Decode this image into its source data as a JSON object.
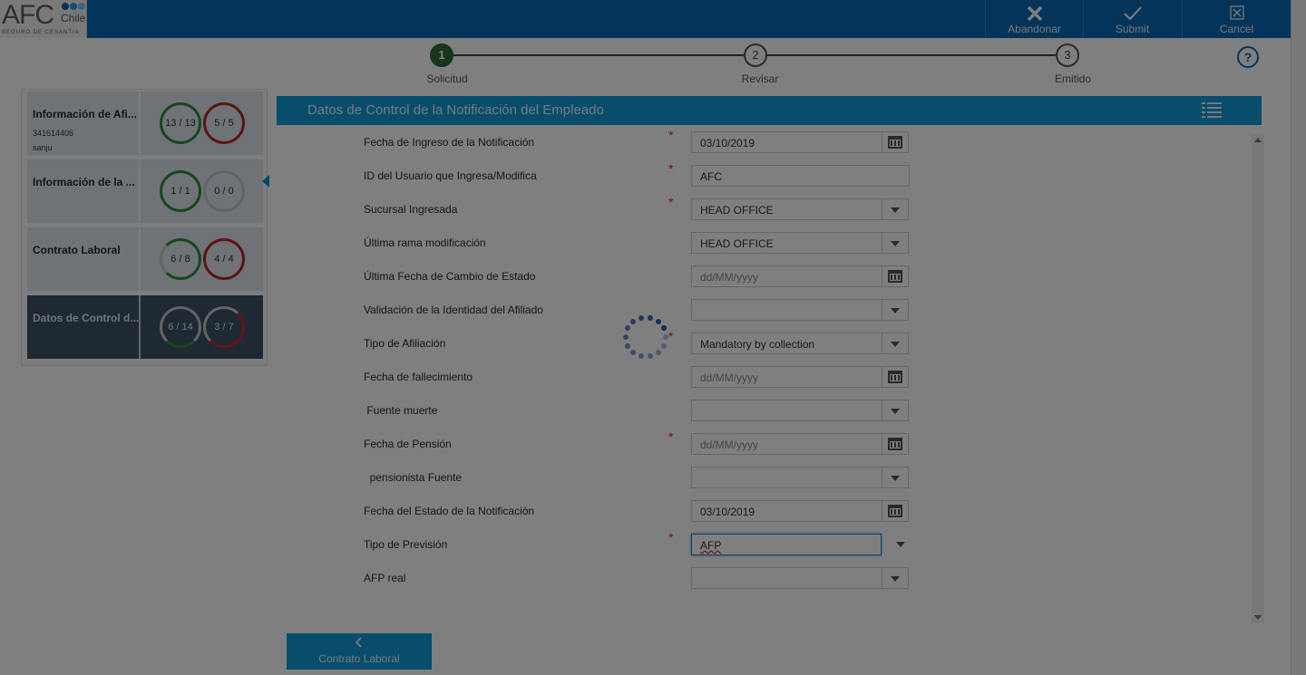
{
  "header": {
    "logo": {
      "brand": "AFC",
      "country": "Chile",
      "tagline": "SEGURO DE CESANTIA",
      "dot_colors": [
        "#1c5aa8",
        "#2f9be0",
        "#7ec7f0"
      ]
    },
    "actions": [
      {
        "label": "Abandonar",
        "icon": "close-x-icon"
      },
      {
        "label": "Submit",
        "icon": "checkmark-icon"
      },
      {
        "label": "Cancel",
        "icon": "cancel-box-icon"
      }
    ]
  },
  "stepper": {
    "steps": [
      {
        "number": "1",
        "label": "Solicitud",
        "active": true
      },
      {
        "number": "2",
        "label": "Revisar",
        "active": false
      },
      {
        "number": "3",
        "label": "Emitido",
        "active": false
      }
    ],
    "help": "?"
  },
  "sidebar": {
    "cards": [
      {
        "title": "Información de Afi...",
        "sub1": "341614406",
        "sub2": "sanju",
        "left": "13 / 13",
        "right": "5 / 5",
        "active": false
      },
      {
        "title": "Información de la ...",
        "left": "1 / 1",
        "right": "0 / 0",
        "active": false,
        "selected": true
      },
      {
        "title": "Contrato Laboral",
        "left": "6 / 8",
        "right": "4 / 4",
        "active": false
      },
      {
        "title": "Datos de Control d...",
        "left": "6 / 14",
        "right": "3 / 7",
        "active": true
      }
    ]
  },
  "section": {
    "title": "Datos de Control de la Notificación del Empleado",
    "icon": "list-view-icon"
  },
  "form": {
    "fields": [
      {
        "label": "Fecha de Ingreso de la Notificación",
        "required": true,
        "value": "03/10/2019",
        "placeholder": "",
        "type": "date"
      },
      {
        "label": "ID del Usuario que Ingresa/Modifica",
        "required": true,
        "value": "AFC",
        "placeholder": "",
        "type": "text"
      },
      {
        "label": "Sucursal Ingresada",
        "required": true,
        "value": "HEAD OFFICE",
        "placeholder": "",
        "type": "select"
      },
      {
        "label": "Última rama modificación",
        "required": false,
        "value": "HEAD OFFICE",
        "placeholder": "",
        "type": "select"
      },
      {
        "label": "Última Fecha de Cambio de Estado",
        "required": false,
        "value": "",
        "placeholder": "dd/MM/yyyy",
        "type": "date"
      },
      {
        "label": "Validación de la Identidad del Afiliado",
        "required": false,
        "value": "",
        "placeholder": "",
        "type": "select"
      },
      {
        "label": "Tipo de Afiliación",
        "required": true,
        "value": "Mandatory by collection",
        "placeholder": "",
        "type": "select"
      },
      {
        "label": "Fecha de fallecimiento",
        "required": false,
        "value": "",
        "placeholder": "dd/MM/yyyy",
        "type": "date"
      },
      {
        "label": " Fuente muerte",
        "required": false,
        "value": "",
        "placeholder": "",
        "type": "select"
      },
      {
        "label": "Fecha de Pensión",
        "required": true,
        "value": "",
        "placeholder": "dd/MM/yyyy",
        "type": "date"
      },
      {
        "label": "  pensionista Fuente",
        "required": false,
        "value": "",
        "placeholder": "",
        "type": "select"
      },
      {
        "label": "Fecha del Estado de la Notificación",
        "required": false,
        "value": "03/10/2019",
        "placeholder": "",
        "type": "date"
      },
      {
        "label": "Tipo de Previsión",
        "required": true,
        "value": "AFP",
        "placeholder": "",
        "type": "select",
        "focused": true
      },
      {
        "label": "AFP real",
        "required": false,
        "value": "",
        "placeholder": "",
        "type": "select"
      }
    ]
  },
  "footer": {
    "back_label": "Contrato Laboral",
    "back_icon": "chevron-left-icon"
  },
  "colors": {
    "primary": "#0a69b4",
    "section": "#109ad8",
    "active_step": "#2f6b35",
    "required": "#dd2222",
    "spinner": "#1a4fa8"
  }
}
